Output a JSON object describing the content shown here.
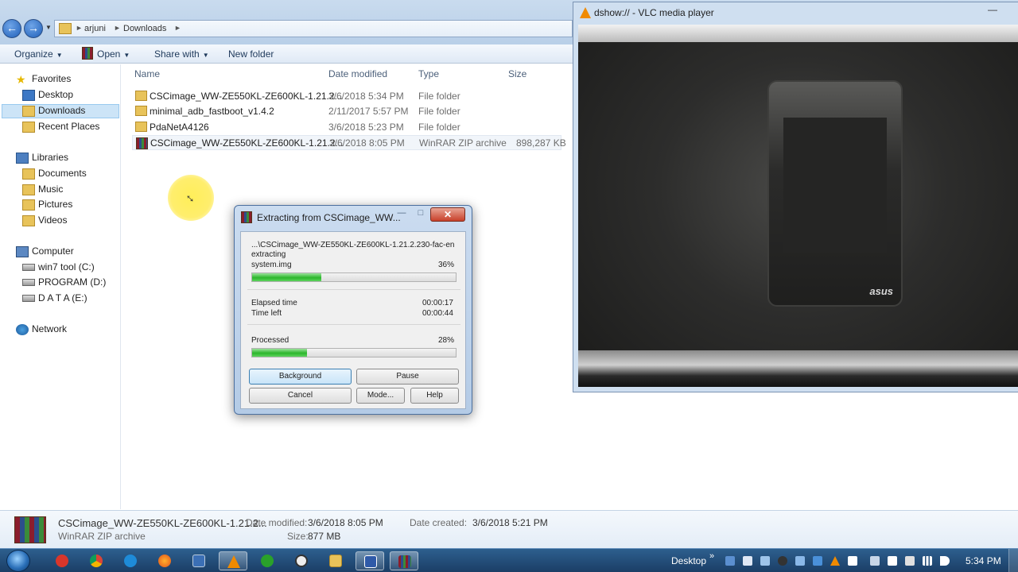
{
  "explorer": {
    "breadcrumb": [
      "arjuni",
      "Downloads"
    ],
    "commands": {
      "organize": "Organize",
      "open": "Open",
      "share": "Share with",
      "new_folder": "New folder"
    },
    "nav": {
      "favorites": "Favorites",
      "desktop": "Desktop",
      "downloads": "Downloads",
      "recent": "Recent Places",
      "libraries": "Libraries",
      "documents": "Documents",
      "music": "Music",
      "pictures": "Pictures",
      "videos": "Videos",
      "computer": "Computer",
      "drive_c": "win7 tool (C:)",
      "drive_d": "PROGRAM (D:)",
      "drive_e": "D A T A (E:)",
      "network": "Network"
    },
    "columns": {
      "name": "Name",
      "date": "Date modified",
      "type": "Type",
      "size": "Size"
    },
    "files": [
      {
        "name": "CSCimage_WW-ZE550KL-ZE600KL-1.21.2...",
        "date": "3/6/2018 5:34 PM",
        "type": "File folder",
        "size": ""
      },
      {
        "name": "minimal_adb_fastboot_v1.4.2",
        "date": "2/11/2017 5:57 PM",
        "type": "File folder",
        "size": ""
      },
      {
        "name": "PdaNetA4126",
        "date": "3/6/2018 5:23 PM",
        "type": "File folder",
        "size": ""
      },
      {
        "name": "CSCimage_WW-ZE550KL-ZE600KL-1.21.2...",
        "date": "3/6/2018 8:05 PM",
        "type": "WinRAR ZIP archive",
        "size": "898,287 KB"
      }
    ],
    "details": {
      "filename": "CSCimage_WW-ZE550KL-ZE600KL-1.21.2...",
      "filetype": "WinRAR ZIP archive",
      "date_modified_label": "Date modified:",
      "date_modified": "3/6/2018 8:05 PM",
      "size_label": "Size:",
      "size": "877 MB",
      "date_created_label": "Date created:",
      "date_created": "3/6/2018 5:21 PM"
    }
  },
  "vlc": {
    "title": "dshow:// - VLC media player",
    "phone_logo": "asus"
  },
  "rar": {
    "title": "Extracting from CSCimage_WW...",
    "path": "...\\CSCimage_WW-ZE550KL-ZE600KL-1.21.2.230-fac-en",
    "action": "extracting",
    "current_file": "system.img",
    "file_percent": "36%",
    "file_progress": 0.34,
    "elapsed_label": "Elapsed time",
    "elapsed": "00:00:17",
    "left_label": "Time left",
    "left": "00:00:44",
    "processed_label": "Processed",
    "processed_percent": "28%",
    "processed_progress": 0.27,
    "buttons": {
      "background": "Background",
      "pause": "Pause",
      "cancel": "Cancel",
      "mode": "Mode...",
      "help": "Help"
    }
  },
  "taskbar": {
    "desktop_label": "Desktop",
    "clock": "5:34 PM"
  }
}
